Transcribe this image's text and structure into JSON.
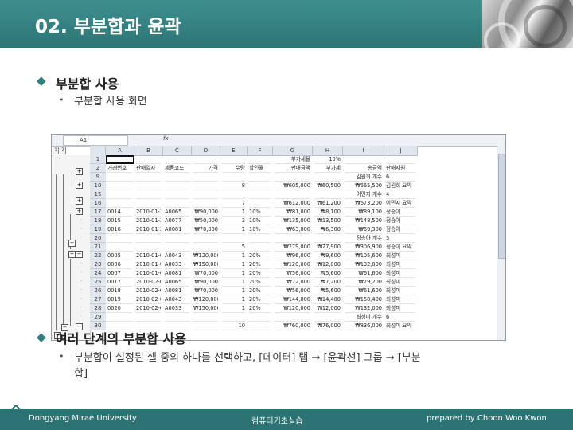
{
  "slide": {
    "title": "02. 부분합과 윤곽",
    "section1": {
      "heading": "부분합 사용",
      "sub": "부분합 사용 화면"
    },
    "section2": {
      "heading": "여러 단계의 부분합 사용",
      "sub_line1": "부분합이 설정된 셀 중의 하나를 선택하고, [데이터] 탭 → [윤곽선] 그룹 → [부분",
      "sub_line2": "합]"
    }
  },
  "colors": {
    "header": "#2d7575",
    "accent": "#2e8080",
    "footer": "#2d7373"
  },
  "footer": {
    "left": "Dongyang Mirae University",
    "center": "컴퓨터기초실습",
    "right": "prepared by Choon Woo Kwon"
  },
  "spreadsheet": {
    "name_box": "A1",
    "fx": "fx",
    "levels": [
      "1",
      "2",
      "3",
      "4"
    ],
    "columns": [
      "A",
      "B",
      "C",
      "D",
      "E",
      "F",
      "G",
      "H",
      "I",
      "J"
    ],
    "rows": [
      {
        "n": "1",
        "c": [
          "",
          "",
          "",
          "",
          "",
          "",
          "부가세율",
          "10%",
          "",
          ""
        ]
      },
      {
        "n": "2",
        "c": [
          "거래번호",
          "판매일자",
          "제품코드",
          "가격",
          "수량",
          "할인율",
          "판매금액",
          "부가세",
          "총금액",
          "판매사원"
        ]
      },
      {
        "n": "9",
        "c": [
          "",
          "",
          "",
          "",
          "",
          "",
          "",
          "",
          "김원희 개수",
          "6"
        ]
      },
      {
        "n": "10",
        "c": [
          "",
          "",
          "",
          "",
          "8",
          "",
          "₩605,000",
          "₩60,500",
          "₩665,500",
          "김원희 요약"
        ]
      },
      {
        "n": "15",
        "c": [
          "",
          "",
          "",
          "",
          "",
          "",
          "",
          "",
          "이민지 개수",
          "4"
        ]
      },
      {
        "n": "16",
        "c": [
          "",
          "",
          "",
          "",
          "7",
          "",
          "₩612,000",
          "₩61,200",
          "₩673,200",
          "이민지 요약"
        ]
      },
      {
        "n": "17",
        "c": [
          "0014",
          "2010-01-25",
          "A0065",
          "₩90,000",
          "1",
          "10%",
          "₩81,000",
          "₩8,100",
          "₩89,100",
          "정승아"
        ]
      },
      {
        "n": "18",
        "c": [
          "0015",
          "2010-01-25",
          "A0077",
          "₩50,000",
          "3",
          "10%",
          "₩135,000",
          "₩13,500",
          "₩148,500",
          "정승아"
        ]
      },
      {
        "n": "19",
        "c": [
          "0016",
          "2010-01-25",
          "A0081",
          "₩70,000",
          "1",
          "10%",
          "₩63,000",
          "₩6,300",
          "₩69,300",
          "정승아"
        ]
      },
      {
        "n": "20",
        "c": [
          "",
          "",
          "",
          "",
          "",
          "",
          "",
          "",
          "정승아 개수",
          "3"
        ]
      },
      {
        "n": "21",
        "c": [
          "",
          "",
          "",
          "",
          "5",
          "",
          "₩279,000",
          "₩27,900",
          "₩306,900",
          "정승아 요약"
        ]
      },
      {
        "n": "22",
        "c": [
          "0005",
          "2010-01-06",
          "A0043",
          "₩120,000",
          "1",
          "20%",
          "₩96,000",
          "₩9,600",
          "₩105,600",
          "최성미"
        ]
      },
      {
        "n": "23",
        "c": [
          "0006",
          "2010-01-06",
          "A0033",
          "₩150,000",
          "1",
          "20%",
          "₩120,000",
          "₩12,000",
          "₩132,000",
          "최성미"
        ]
      },
      {
        "n": "24",
        "c": [
          "0007",
          "2010-01-06",
          "A0081",
          "₩70,000",
          "1",
          "20%",
          "₩56,000",
          "₩5,600",
          "₩61,600",
          "최성미"
        ]
      },
      {
        "n": "25",
        "c": [
          "0017",
          "2010-02-03",
          "A0065",
          "₩90,000",
          "1",
          "20%",
          "₩72,000",
          "₩7,200",
          "₩79,200",
          "최성미"
        ]
      },
      {
        "n": "26",
        "c": [
          "0018",
          "2010-02-03",
          "A0081",
          "₩70,000",
          "1",
          "20%",
          "₩56,000",
          "₩5,600",
          "₩61,600",
          "최성미"
        ]
      },
      {
        "n": "27",
        "c": [
          "0019",
          "2010-02-03",
          "A0043",
          "₩120,000",
          "1",
          "20%",
          "₩144,000",
          "₩14,400",
          "₩158,400",
          "최성미"
        ]
      },
      {
        "n": "28",
        "c": [
          "0020",
          "2010-02-03",
          "A0033",
          "₩150,000",
          "1",
          "20%",
          "₩120,000",
          "₩12,000",
          "₩132,000",
          "최성미"
        ]
      },
      {
        "n": "29",
        "c": [
          "",
          "",
          "",
          "",
          "",
          "",
          "",
          "",
          "최성미 개수",
          "6"
        ]
      },
      {
        "n": "30",
        "c": [
          "",
          "",
          "",
          "",
          "10",
          "",
          "₩760,000",
          "₩76,000",
          "₩836,000",
          "최성미 요약"
        ]
      }
    ]
  }
}
